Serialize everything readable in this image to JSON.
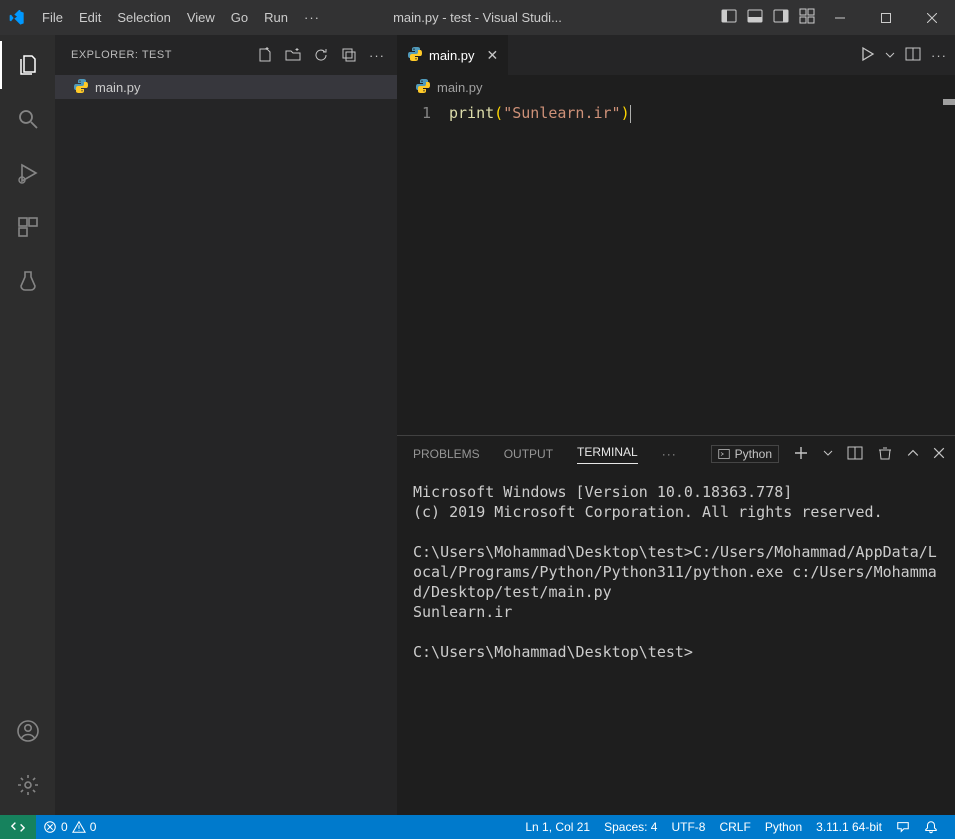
{
  "window": {
    "title": "main.py - test - Visual Studi..."
  },
  "menu": {
    "items": [
      "File",
      "Edit",
      "Selection",
      "View",
      "Go",
      "Run",
      "…"
    ]
  },
  "explorer": {
    "header": "EXPLORER: TEST",
    "file": "main.py"
  },
  "editor": {
    "tab": "main.py",
    "breadcrumb": "main.py",
    "line_number": "1",
    "code": {
      "fn": "print",
      "open": "(",
      "str": "\"Sunlearn.ir\"",
      "close": ")"
    }
  },
  "panel": {
    "tabs": {
      "problems": "PROBLEMS",
      "output": "OUTPUT",
      "terminal": "TERMINAL"
    },
    "interpreter": "Python",
    "terminal_text": "Microsoft Windows [Version 10.0.18363.778]\n(c) 2019 Microsoft Corporation. All rights reserved.\n\nC:\\Users\\Mohammad\\Desktop\\test>C:/Users/Mohammad/AppData/Local/Programs/Python/Python311/python.exe c:/Users/Mohammad/Desktop/test/main.py\nSunlearn.ir\n\nC:\\Users\\Mohammad\\Desktop\\test>"
  },
  "status": {
    "errors": "0",
    "warnings": "0",
    "ln_col": "Ln 1, Col 21",
    "spaces": "Spaces: 4",
    "encoding": "UTF-8",
    "eol": "CRLF",
    "language": "Python",
    "interpreter": "3.11.1 64-bit"
  }
}
